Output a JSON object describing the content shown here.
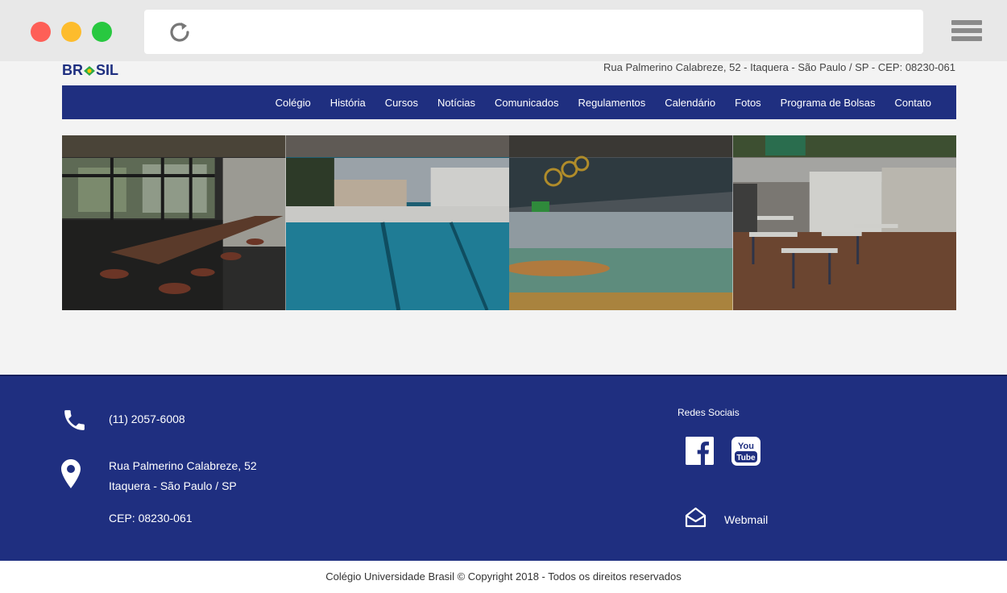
{
  "header": {
    "logo_text": "BR SIL",
    "address": "Rua Palmerino Calabreze, 52 - Itaquera - São Paulo / SP - CEP: 08230-061"
  },
  "nav": {
    "items": [
      {
        "label": "Colégio"
      },
      {
        "label": "História"
      },
      {
        "label": "Cursos"
      },
      {
        "label": "Notícias"
      },
      {
        "label": "Comunicados"
      },
      {
        "label": "Regulamentos"
      },
      {
        "label": "Calendário"
      },
      {
        "label": "Fotos"
      },
      {
        "label": "Programa de Bolsas"
      },
      {
        "label": "Contato"
      }
    ]
  },
  "gallery": {
    "photos": [
      "cafeteria-photo",
      "pool-photo",
      "gym-photo",
      "classroom-photo"
    ]
  },
  "footer": {
    "phone": "(11) 2057-6008",
    "address_line1": "Rua Palmerino Calabreze, 52",
    "address_line2": "Itaquera - São Paulo / SP",
    "cep": "CEP: 08230-061",
    "social_title": "Redes Sociais",
    "webmail_label": "Webmail",
    "youtube_top": "You",
    "youtube_bottom": "Tube"
  },
  "copyright": "Colégio Universidade Brasil © Copyright 2018 - Todos os direitos reservados",
  "colors": {
    "brand_blue": "#1f2f80",
    "chrome_bg": "#e8e8e8"
  }
}
